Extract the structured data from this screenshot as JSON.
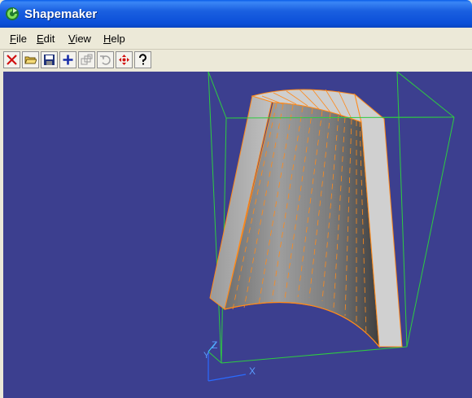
{
  "window": {
    "title": "Shapemaker"
  },
  "menu": {
    "items": [
      {
        "id": "file",
        "hot": "F",
        "rest": "ile"
      },
      {
        "id": "edit",
        "hot": "E",
        "rest": "dit"
      },
      {
        "id": "view",
        "hot": "V",
        "rest": "iew"
      },
      {
        "id": "help",
        "hot": "H",
        "rest": "elp"
      }
    ]
  },
  "toolbar": {
    "buttons": [
      {
        "icon": "delete-x-icon",
        "enabled": true
      },
      {
        "icon": "open-folder-icon",
        "enabled": true
      },
      {
        "icon": "save-disk-icon",
        "enabled": true
      },
      {
        "icon": "add-plus-icon",
        "enabled": true
      },
      {
        "icon": "copy-shapes-icon",
        "enabled": false
      },
      {
        "icon": "undo-icon",
        "enabled": false
      },
      {
        "icon": "move-arrows-icon",
        "enabled": true
      },
      {
        "icon": "help-question-icon",
        "enabled": true
      }
    ]
  },
  "viewport": {
    "background": "#3c3f8f",
    "bounding_box_color": "#2ecc40",
    "edge_color": "#ff8a1a",
    "surface_color": "#b8b8b8",
    "axes": {
      "x": "X",
      "y": "Y",
      "z": "Z"
    }
  }
}
